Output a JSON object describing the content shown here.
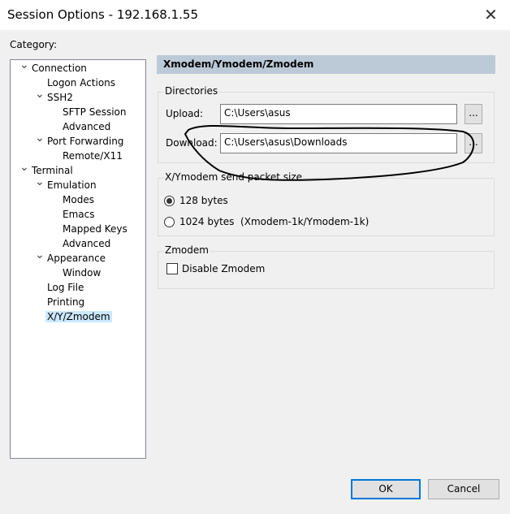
{
  "window": {
    "title": "Session Options - 192.168.1.55",
    "close_icon": "close-icon"
  },
  "category_label": "Category:",
  "tree": [
    {
      "label": "Connection",
      "level": 0,
      "expanded": true
    },
    {
      "label": "Logon Actions",
      "level": 1
    },
    {
      "label": "SSH2",
      "level": 1,
      "expanded": true
    },
    {
      "label": "SFTP Session",
      "level": 2
    },
    {
      "label": "Advanced",
      "level": 2
    },
    {
      "label": "Port Forwarding",
      "level": 1,
      "expanded": true
    },
    {
      "label": "Remote/X11",
      "level": 2
    },
    {
      "label": "Terminal",
      "level": 0,
      "expanded": true
    },
    {
      "label": "Emulation",
      "level": 1,
      "expanded": true
    },
    {
      "label": "Modes",
      "level": 2
    },
    {
      "label": "Emacs",
      "level": 2
    },
    {
      "label": "Mapped Keys",
      "level": 2
    },
    {
      "label": "Advanced",
      "level": 2
    },
    {
      "label": "Appearance",
      "level": 1,
      "expanded": true
    },
    {
      "label": "Window",
      "level": 2
    },
    {
      "label": "Log File",
      "level": 1
    },
    {
      "label": "Printing",
      "level": 1
    },
    {
      "label": "X/Y/Zmodem",
      "level": 1,
      "selected": true
    }
  ],
  "panel": {
    "header": "Xmodem/Ymodem/Zmodem",
    "directories": {
      "label": "Directories",
      "upload_label": "Upload:",
      "upload_value": "C:\\Users\\asus",
      "download_label": "Download:",
      "download_value": "C:\\Users\\asus\\Downloads",
      "browse_label": "..."
    },
    "packet": {
      "label": "X/Ymodem send packet size",
      "options": [
        {
          "label": "128 bytes",
          "selected": true
        },
        {
          "label": "1024 bytes  (Xmodem-1k/Ymodem-1k)",
          "selected": false
        }
      ]
    },
    "zmodem": {
      "label": "Zmodem",
      "disable_label": "Disable Zmodem",
      "disable_checked": false
    }
  },
  "buttons": {
    "ok": "OK",
    "cancel": "Cancel"
  },
  "colors": {
    "header_bg": "#bccad8",
    "selection": "#cce8ff",
    "default_button_border": "#0078d7"
  }
}
